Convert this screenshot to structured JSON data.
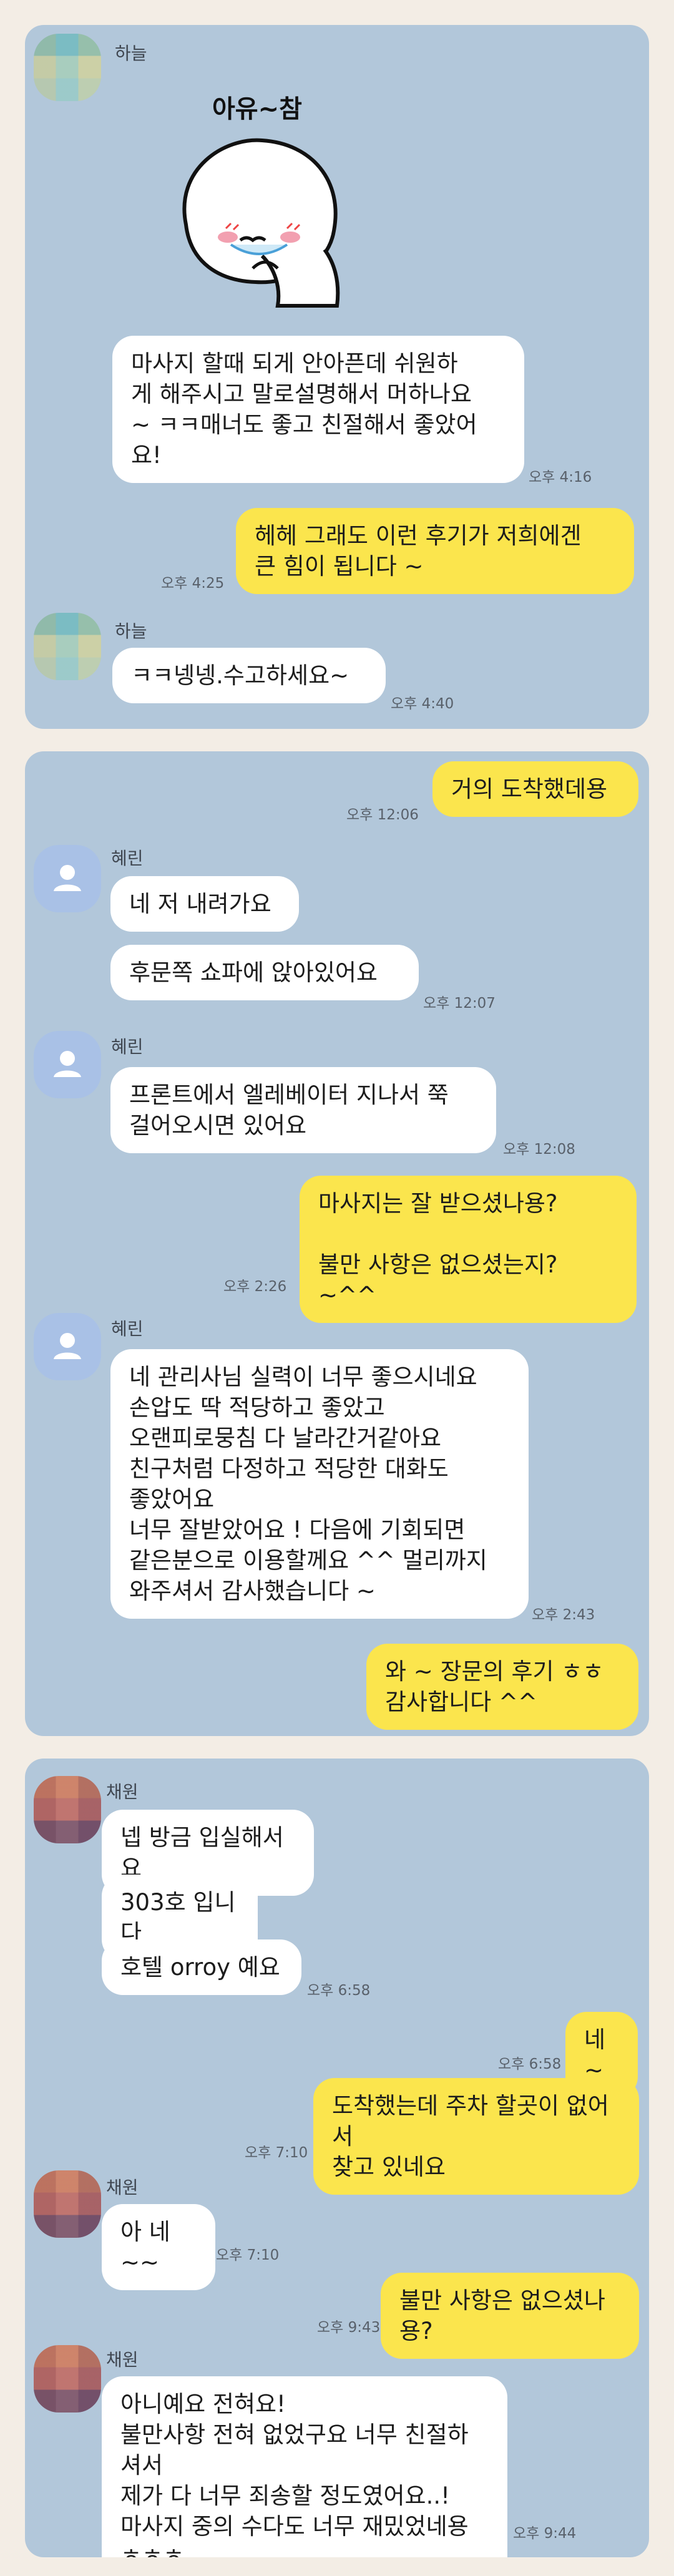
{
  "colors": {
    "page_bg": "#f3ede5",
    "chat_bg": "#b2c7da",
    "incoming_bubble": "#ffffff",
    "outgoing_bubble": "#fbe54d"
  },
  "panel1": {
    "sender_name_1": "하늘",
    "sticker_caption": "아유~참",
    "sticker_icon": "embarrassed-blob-sticker",
    "msg1": "마사지 할때 되게 안아픈데 쉬원하\n게 해주시고 말로설명해서 머하나요\n~ ㅋㅋ매너도 좋고 친절해서 좋았어\n요!",
    "time1": "오후 4:16",
    "reply1": "헤헤 그래도 이런 후기가 저희에겐\n큰 힘이 됩니다 ~",
    "reply1_time": "오후 4:25",
    "sender_name_2": "하늘",
    "msg2": "ㅋㅋ넹넹.수고하세요~",
    "time2": "오후 4:40"
  },
  "panel2": {
    "out1": "거의 도착했데용",
    "out1_time": "오후 12:06",
    "sender_name_1": "혜린",
    "in1": "네 저 내려가요",
    "in2": "후문쪽 쇼파에 앉아있어요",
    "in2_time": "오후 12:07",
    "sender_name_2": "혜린",
    "in3": "프론트에서 엘레베이터 지나서 쭉\n걸어오시면 있어요",
    "in3_time": "오후 12:08",
    "out2": "마사지는 잘 받으셨나용?\n\n불만 사항은 없으셨는지? ~^^",
    "out2_time": "오후 2:26",
    "sender_name_3": "혜린",
    "in4": "네 관리사님 실력이 너무 좋으시네요\n손압도 딱 적당하고 좋았고\n오랜피로뭉침 다 날라간거같아요\n친구처럼 다정하고 적당한 대화도\n좋았어요\n너무 잘받았어요 ! 다음에 기회되면\n같은분으로 이용할께요 ^^ 멀리까지\n와주셔서 감사했습니다 ~",
    "in4_time": "오후 2:43",
    "out3": "와 ~ 장문의 후기 ㅎㅎ\n감사합니다 ^^"
  },
  "panel3": {
    "sender_name_1": "채원",
    "in1": "넵 방금 입실해서요",
    "in2": "303호 입니다",
    "in3": "호텔 orroy 예요",
    "in3_time": "오후 6:58",
    "out1": "네 ~",
    "out1_time": "오후 6:58",
    "out2": "도착했는데  주차 할곳이 없어서\n찾고 있네요",
    "out2_time": "오후 7:10",
    "sender_name_2": "채원",
    "in4": "아 네~~",
    "in4_time": "오후 7:10",
    "out3": "불만 사항은 없으셨나용?",
    "out3_time": "오후 9:43",
    "sender_name_3": "채원",
    "in5": "아니예요 전혀요!\n불만사항 전혀 없었구요 너무 친절하셔서\n제가 다 너무 죄송할 정도였어요..!\n마사지 중의 수다도 너무 재밌었네용\nㅎㅎㅎ",
    "in5_time": "오후 9:44"
  }
}
